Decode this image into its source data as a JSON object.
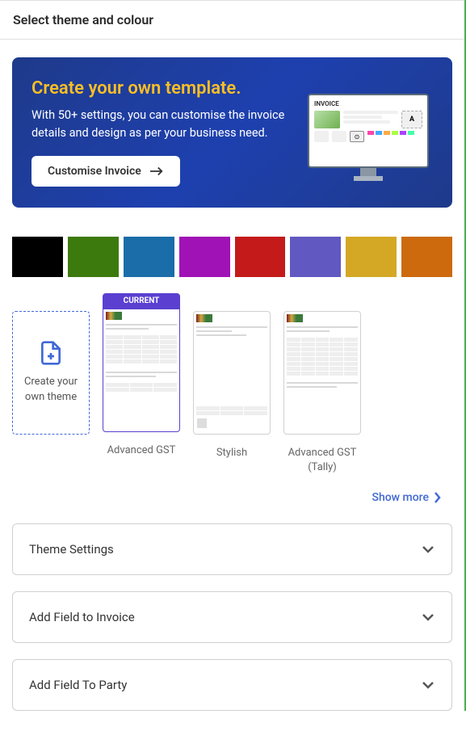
{
  "header": {
    "title": "Select theme and colour"
  },
  "banner": {
    "title": "Create your own template.",
    "description": "With 50+ settings, you can customise the invoice details and design as per your business need.",
    "button_label": "Customise Invoice",
    "graphic_title": "INVOICE"
  },
  "colors": [
    "#000000",
    "#3d7a0e",
    "#1a6da8",
    "#a012b5",
    "#c41a1a",
    "#6159c1",
    "#d4a825",
    "#cc6a0d"
  ],
  "themes": {
    "create_label": "Create your own theme",
    "current_tag": "CURRENT",
    "items": [
      {
        "label": "Advanced GST",
        "current": true
      },
      {
        "label": "Stylish",
        "current": false
      },
      {
        "label": "Advanced GST (Tally)",
        "current": false
      }
    ],
    "show_more_label": "Show more"
  },
  "accordions": [
    {
      "label": "Theme Settings"
    },
    {
      "label": "Add Field to Invoice"
    },
    {
      "label": "Add Field To Party"
    }
  ]
}
